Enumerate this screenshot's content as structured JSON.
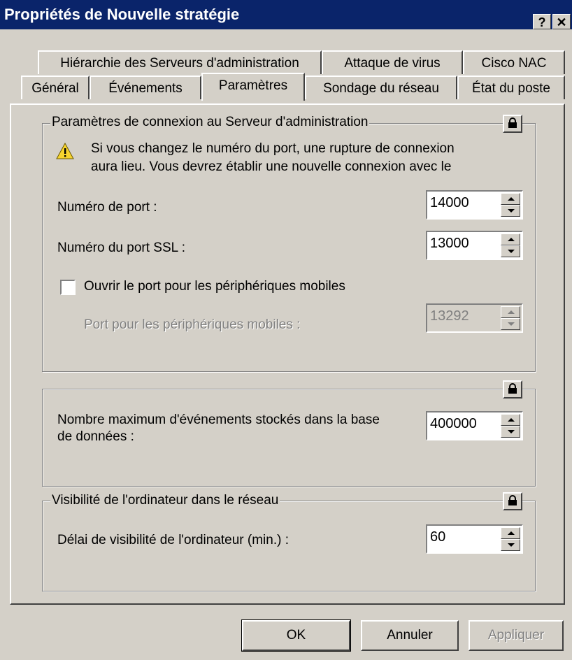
{
  "window": {
    "title": "Propriétés de Nouvelle stratégie",
    "help_label": "?",
    "close_label": "✕"
  },
  "tabs_row1": [
    {
      "label": "Hiérarchie des Serveurs d'administration"
    },
    {
      "label": "Attaque de virus"
    },
    {
      "label": "Cisco NAC"
    }
  ],
  "tabs_row2": [
    {
      "label": "Général"
    },
    {
      "label": "Événements"
    },
    {
      "label": "Paramètres",
      "active": true
    },
    {
      "label": "Sondage du réseau"
    },
    {
      "label": "État du poste"
    }
  ],
  "connection_group": {
    "legend": "Paramètres de connexion au Serveur d'administration",
    "warning_line1": "Si vous changez le numéro du port, une rupture de connexion",
    "warning_line2": "aura lieu. Vous devrez établir une nouvelle connexion avec le",
    "port_label": "Numéro de port :",
    "port_value": "14000",
    "ssl_label": "Numéro du port SSL :",
    "ssl_value": "13000",
    "mobile_checkbox_label": "Ouvrir le port pour les périphériques mobiles",
    "mobile_checked": false,
    "mobile_port_label": "Port pour les périphériques mobiles :",
    "mobile_port_value": "13292"
  },
  "events_group": {
    "max_events_line1": "Nombre maximum d'événements stockés dans la base",
    "max_events_line2": "de données :",
    "max_events_value": "400000"
  },
  "visibility_group": {
    "legend": "Visibilité de l'ordinateur dans le réseau",
    "delay_label": "Délai de visibilité de l'ordinateur (min.) :",
    "delay_value": "60"
  },
  "buttons": {
    "ok": "OK",
    "cancel": "Annuler",
    "apply": "Appliquer"
  },
  "icons": {
    "warning": "warning-icon",
    "lock": "lock-icon"
  },
  "colors": {
    "titlebar": "#0a246a",
    "face": "#d4d0c8",
    "warning": "#f7d42e"
  }
}
